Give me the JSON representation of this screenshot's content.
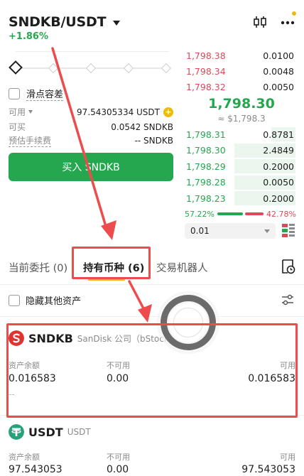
{
  "header": {
    "pair": "SNDKB/USDT",
    "change": "+1.86%",
    "kline_icon": "candlestick-icon",
    "more_icon": "more-dots-icon"
  },
  "form": {
    "slippage_label": "滑点容差",
    "available_label": "可用",
    "available_value": "97.54305334 USDT",
    "can_buy_label": "可买",
    "can_buy_value": "0.0542 SNDKB",
    "fee_label": "预估手续费",
    "fee_value": "-- SNDKB",
    "buy_button": "买入 SNDKB"
  },
  "orderbook": {
    "asks": [
      {
        "price": "1,798.38",
        "qty": "0.0100"
      },
      {
        "price": "1,798.34",
        "qty": "0.0048"
      },
      {
        "price": "1,798.32",
        "qty": "0.0050"
      }
    ],
    "mid_price": "1,798.30",
    "mid_fiat": "≈ $1,798.3",
    "bids": [
      {
        "price": "1,798.31",
        "qty": "0.8781",
        "depth": 0.22
      },
      {
        "price": "1,798.30",
        "qty": "2.4849",
        "depth": 0.55
      },
      {
        "price": "1,798.29",
        "qty": "0.2000",
        "depth": 0.55
      },
      {
        "price": "1,798.28",
        "qty": "0.0050",
        "depth": 0.55
      },
      {
        "price": "1,798.23",
        "qty": "0.2000",
        "depth": 0.55
      }
    ],
    "buy_ratio": "57.22%",
    "sell_ratio": "42.78%",
    "depth_value": "0.01"
  },
  "tabs": {
    "open_orders": "当前委托 (0)",
    "holdings": "持有币种 (6)",
    "bots": "交易机器人"
  },
  "filter": {
    "hide_other_label": "隐藏其他资产"
  },
  "assets": [
    {
      "symbol": "SNDKB",
      "name": "SanDisk 公司（bStock",
      "balance_label": "资产余额",
      "balance": "0.016583",
      "unavailable_label": "不可用",
      "unavailable": "0.00",
      "available_label": "可用",
      "available": "0.016583",
      "extra": "--"
    },
    {
      "symbol": "USDT",
      "name": "USDT",
      "balance_label": "资产余额",
      "balance": "97.543053",
      "unavailable_label": "不可用",
      "unavailable": "0.00",
      "available_label": "可用",
      "available": "97.543053"
    }
  ],
  "colors": {
    "green": "#25a750",
    "red": "#e0485a",
    "accent": "#f0b90b",
    "annotation": "#ee4c4c"
  }
}
